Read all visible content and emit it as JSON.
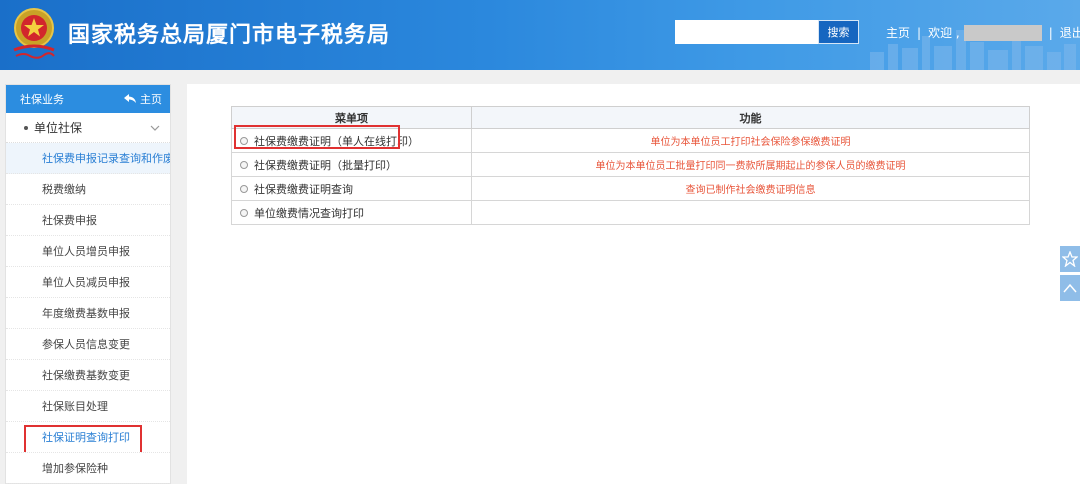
{
  "header": {
    "title": "国家税务总局厦门市电子税务局",
    "search": {
      "value": "",
      "button_label": "搜索"
    },
    "nav": {
      "home": "主页",
      "welcome": "欢迎 ,",
      "logout": "退出",
      "separator": "|"
    }
  },
  "sidebar": {
    "header_label": "社保业务",
    "home_link": "主页",
    "group_label": "单位社保",
    "items": [
      {
        "label": "社保费申报记录查询和作废",
        "state": "active"
      },
      {
        "label": "税费缴纳",
        "state": "normal"
      },
      {
        "label": "社保费申报",
        "state": "normal"
      },
      {
        "label": "单位人员增员申报",
        "state": "normal"
      },
      {
        "label": "单位人员减员申报",
        "state": "normal"
      },
      {
        "label": "年度缴费基数申报",
        "state": "normal"
      },
      {
        "label": "参保人员信息变更",
        "state": "normal"
      },
      {
        "label": "社保缴费基数变更",
        "state": "normal"
      },
      {
        "label": "社保账目处理",
        "state": "normal"
      },
      {
        "label": "社保证明查询打印",
        "state": "current"
      },
      {
        "label": "增加参保险种",
        "state": "normal"
      }
    ]
  },
  "table": {
    "headers": {
      "name": "菜单项",
      "function": "功能"
    },
    "rows": [
      {
        "name": "社保费缴费证明（单人在线打印）",
        "function": "单位为本单位员工打印社会保险参保缴费证明",
        "highlighted": true
      },
      {
        "name": "社保费缴费证明（批量打印）",
        "function": "单位为本单位员工批量打印同一费款所属期起止的参保人员的缴费证明",
        "highlighted": false
      },
      {
        "name": "社保费缴费证明查询",
        "function": "查询已制作社会缴费证明信息",
        "highlighted": false
      },
      {
        "name": "单位缴费情况查询打印",
        "function": "",
        "highlighted": false
      }
    ]
  },
  "colors": {
    "header_blue": "#2b88dd",
    "sidebar_header": "#2c8de0",
    "link_blue": "#2a7fd4",
    "function_text": "#e8553a",
    "annotation_red": "#e03131"
  },
  "icons": {
    "emblem": "national-tax-emblem",
    "home": "home-arrow-icon",
    "chevron": "chevron-down-icon",
    "star": "star-icon",
    "up": "chevron-up-icon"
  }
}
